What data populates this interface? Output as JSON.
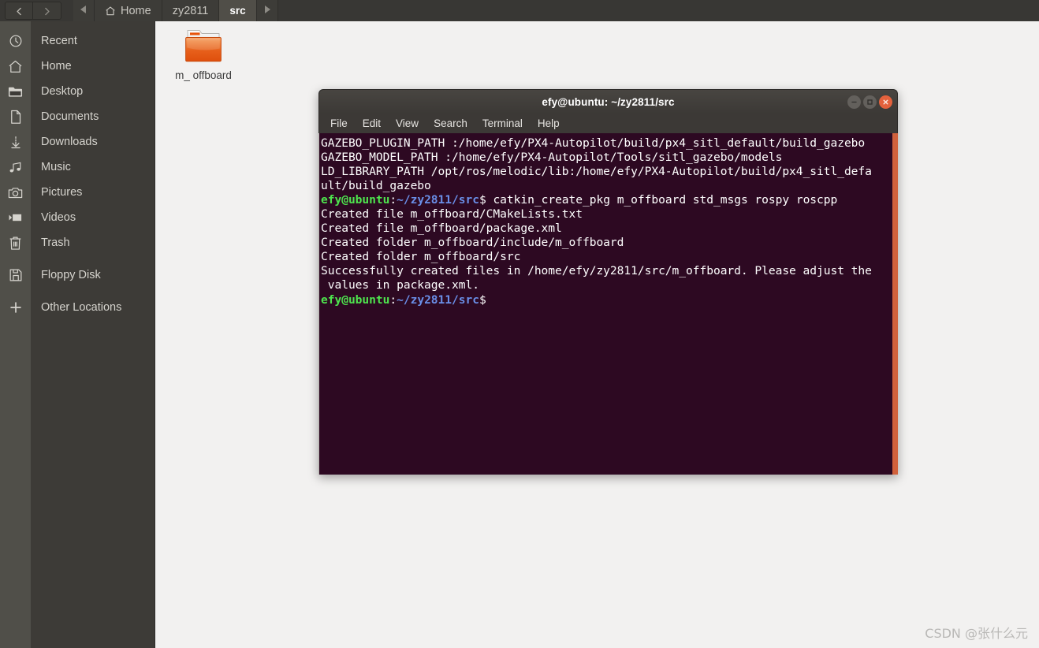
{
  "window": {
    "file_manager_title": "Home"
  },
  "nav": {
    "back_icon": "chevron-left-icon",
    "forward_icon": "chevron-right-icon",
    "path_prev_icon": "triangle-left-icon",
    "path_next_icon": "triangle-right-icon",
    "breadcrumbs": [
      {
        "label": "Home",
        "icon": "home-icon",
        "active": false
      },
      {
        "label": "zy2811",
        "icon": "",
        "active": false
      },
      {
        "label": "src",
        "icon": "",
        "active": true
      }
    ]
  },
  "sidebar": {
    "items": [
      {
        "label": "Recent",
        "icon": "clock-icon"
      },
      {
        "label": "Home",
        "icon": "home-icon"
      },
      {
        "label": "Desktop",
        "icon": "folder-icon"
      },
      {
        "label": "Documents",
        "icon": "document-icon"
      },
      {
        "label": "Downloads",
        "icon": "download-icon"
      },
      {
        "label": "Music",
        "icon": "music-note-icon"
      },
      {
        "label": "Pictures",
        "icon": "camera-icon"
      },
      {
        "label": "Videos",
        "icon": "video-camera-icon"
      },
      {
        "label": "Trash",
        "icon": "trash-icon"
      }
    ],
    "devices": [
      {
        "label": "Floppy Disk",
        "icon": "floppy-disk-icon"
      }
    ],
    "other": [
      {
        "label": "Other Locations",
        "icon": "plus-icon"
      }
    ]
  },
  "files": [
    {
      "label": "m_\noffboard",
      "icon": "folder-icon",
      "color": "#e8540c"
    }
  ],
  "terminal": {
    "title": "efy@ubuntu: ~/zy2811/src",
    "menu": [
      "File",
      "Edit",
      "View",
      "Search",
      "Terminal",
      "Help"
    ],
    "window_buttons": {
      "minimize": "minimize-icon",
      "maximize": "maximize-icon",
      "close": "close-icon"
    },
    "colors": {
      "background": "#2d0922",
      "foreground": "#ffffff",
      "prompt_user": "#4ee44e",
      "prompt_path": "#6a8fe8",
      "titlebar": "#3c3936",
      "scrollbar": "#d1613c"
    },
    "lines": [
      {
        "segments": [
          {
            "text": "GAZEBO_PLUGIN_PATH :/home/efy/PX4-Autopilot/build/px4_sitl_default/build_gazebo",
            "cls": "t-white"
          }
        ]
      },
      {
        "segments": [
          {
            "text": "GAZEBO_MODEL_PATH :/home/efy/PX4-Autopilot/Tools/sitl_gazebo/models",
            "cls": "t-white"
          }
        ]
      },
      {
        "segments": [
          {
            "text": "LD_LIBRARY_PATH /opt/ros/melodic/lib:/home/efy/PX4-Autopilot/build/px4_sitl_defa",
            "cls": "t-white"
          }
        ]
      },
      {
        "segments": [
          {
            "text": "ult/build_gazebo",
            "cls": "t-white"
          }
        ]
      },
      {
        "segments": [
          {
            "text": "efy@ubuntu",
            "cls": "t-green"
          },
          {
            "text": ":",
            "cls": "t-white"
          },
          {
            "text": "~/zy2811/src",
            "cls": "t-blue"
          },
          {
            "text": "$ catkin_create_pkg m_offboard std_msgs rospy roscpp",
            "cls": "t-white"
          }
        ]
      },
      {
        "segments": [
          {
            "text": "Created file m_offboard/CMakeLists.txt",
            "cls": "t-white"
          }
        ]
      },
      {
        "segments": [
          {
            "text": "Created file m_offboard/package.xml",
            "cls": "t-white"
          }
        ]
      },
      {
        "segments": [
          {
            "text": "Created folder m_offboard/include/m_offboard",
            "cls": "t-white"
          }
        ]
      },
      {
        "segments": [
          {
            "text": "Created folder m_offboard/src",
            "cls": "t-white"
          }
        ]
      },
      {
        "segments": [
          {
            "text": "Successfully created files in /home/efy/zy2811/src/m_offboard. Please adjust the",
            "cls": "t-white"
          }
        ]
      },
      {
        "segments": [
          {
            "text": " values in package.xml.",
            "cls": "t-white"
          }
        ]
      },
      {
        "segments": [
          {
            "text": "efy@ubuntu",
            "cls": "t-green"
          },
          {
            "text": ":",
            "cls": "t-white"
          },
          {
            "text": "~/zy2811/src",
            "cls": "t-blue"
          },
          {
            "text": "$",
            "cls": "t-white"
          }
        ]
      }
    ]
  },
  "watermark": {
    "text": "CSDN @张什么元"
  }
}
